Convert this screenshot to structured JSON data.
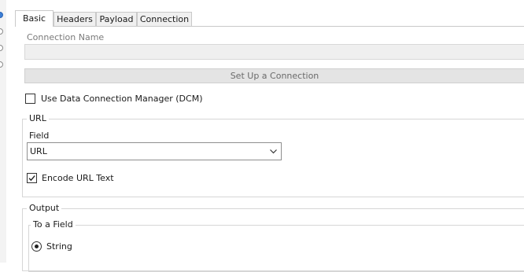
{
  "tabs": [
    {
      "label": "Basic",
      "active": true
    },
    {
      "label": "Headers",
      "active": false
    },
    {
      "label": "Payload",
      "active": false
    },
    {
      "label": "Connection",
      "active": false
    }
  ],
  "connection": {
    "name_label": "Connection Name",
    "name_value": "",
    "setup_button": "Set Up a Connection"
  },
  "dcm": {
    "label": "Use Data Connection Manager (DCM)",
    "checked": false
  },
  "url_group": {
    "title": "URL",
    "field_label": "Field",
    "field_value": "URL",
    "encode_label": "Encode URL Text",
    "encode_checked": true
  },
  "output_group": {
    "title": "Output",
    "to_field_title": "To a Field",
    "string_label": "String",
    "string_selected": true
  },
  "icons": [
    "dropdown-chevron-icon",
    "checkmark-icon"
  ]
}
